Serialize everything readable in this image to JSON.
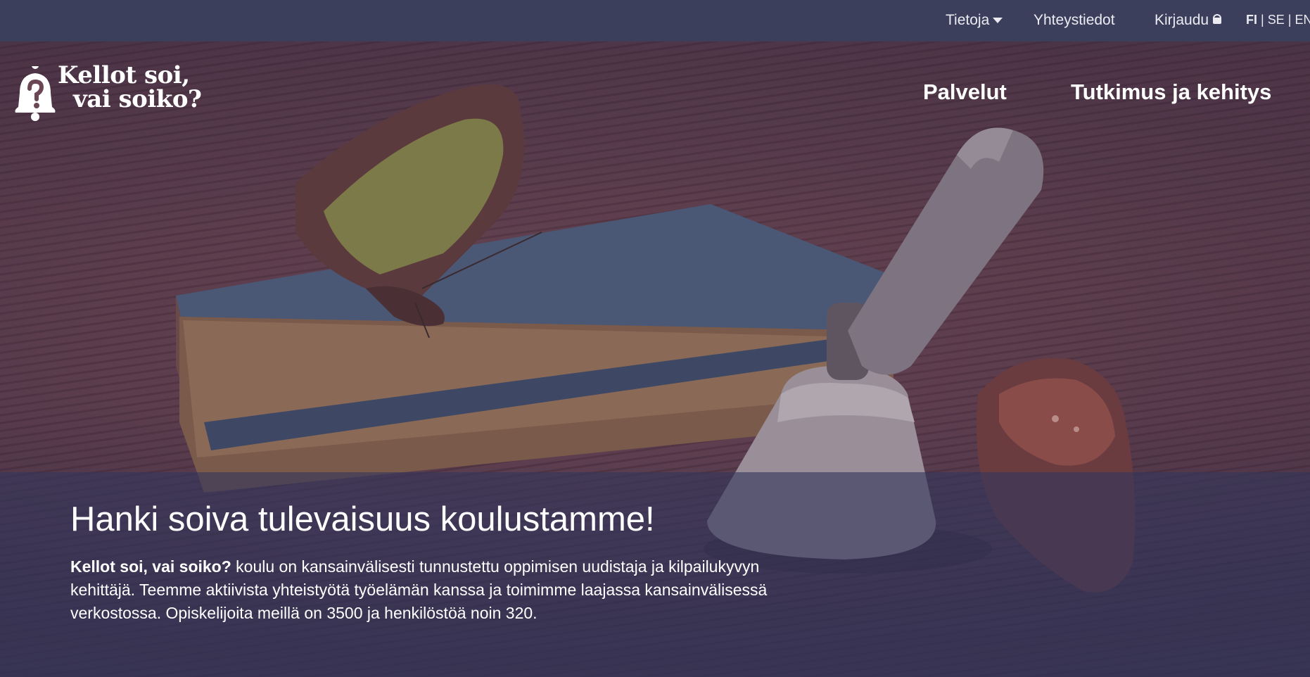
{
  "topbar": {
    "about_label": "Tietoja",
    "contact_label": "Yhteystiedot",
    "login_label": "Kirjaudu",
    "languages": {
      "fi": "FI",
      "se": "SE",
      "en": "EN",
      "separator": "|"
    }
  },
  "logo": {
    "line1": "Kellot soi,",
    "line2": "vai soiko?"
  },
  "main_nav": {
    "services": "Palvelut",
    "research": "Tutkimus ja kehitys"
  },
  "hero": {
    "headline": "Hanki soiva tulevaisuus koulustamme!",
    "description_bold": "Kellot soi, vai soiko?",
    "description_rest": " koulu on kansainvälisesti tunnustettu oppimisen uudistaja ja kilpailukyvyn kehittäjä. Teemme aktiivista yhteistyötä työelämän kanssa ja toimimme laajassa kansainvälisessä verkostossa. Opiskelijoita meillä on 3500 ja henkilöstöä noin 320."
  },
  "colors": {
    "topbar_bg": "#3b3f5c",
    "band_overlay": "rgba(52,55,92,0.62)",
    "text": "#ffffff"
  }
}
